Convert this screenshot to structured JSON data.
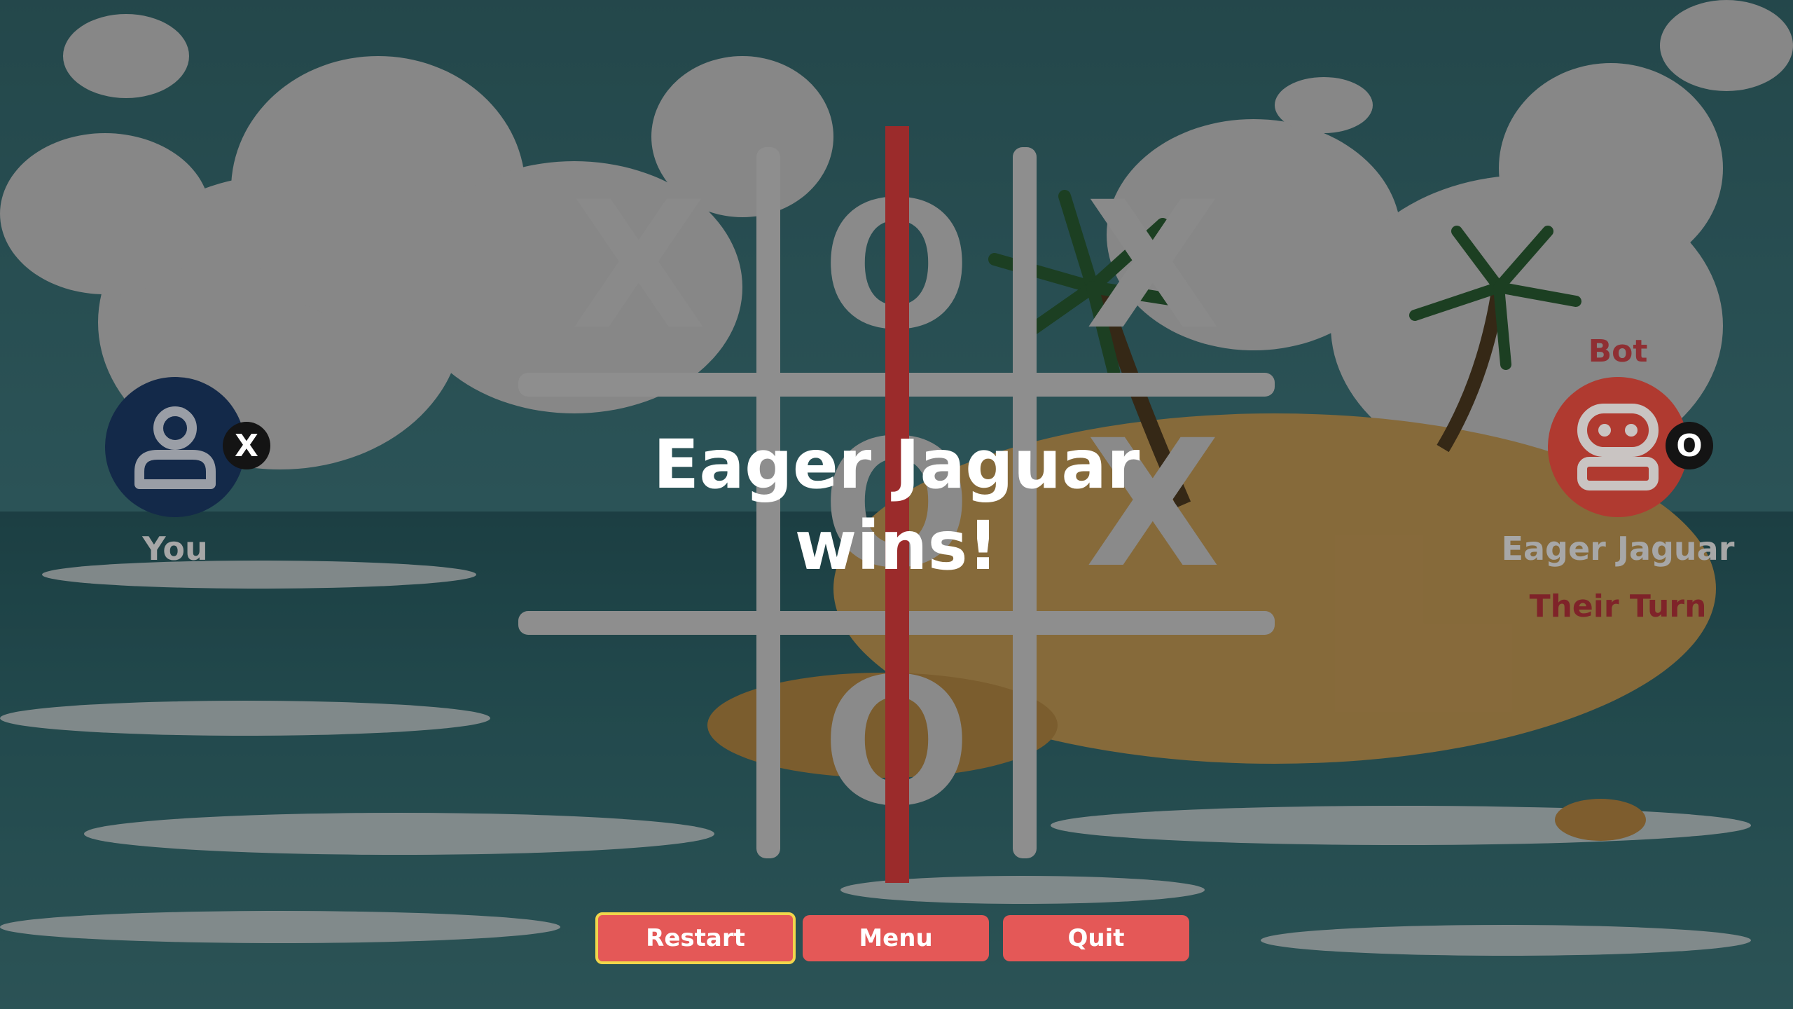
{
  "board": {
    "cells": [
      "X",
      "O",
      "X",
      "",
      "O",
      "X",
      "",
      "O",
      ""
    ]
  },
  "result": {
    "winner_text": "Eager Jaguar wins!"
  },
  "players": {
    "left": {
      "name": "You",
      "symbol": "X",
      "avatar_icon": "person-icon",
      "color": "#132949"
    },
    "right": {
      "role": "Bot",
      "name": "Eager Jaguar",
      "symbol": "O",
      "status": "Their Turn",
      "avatar_icon": "robot-icon",
      "color": "#b03a30"
    }
  },
  "buttons": {
    "restart": "Restart",
    "menu": "Menu",
    "quit": "Quit"
  },
  "colors": {
    "win_line": "#9b2b2b",
    "button": "#e45857",
    "focus_outline": "#f1d64b"
  }
}
